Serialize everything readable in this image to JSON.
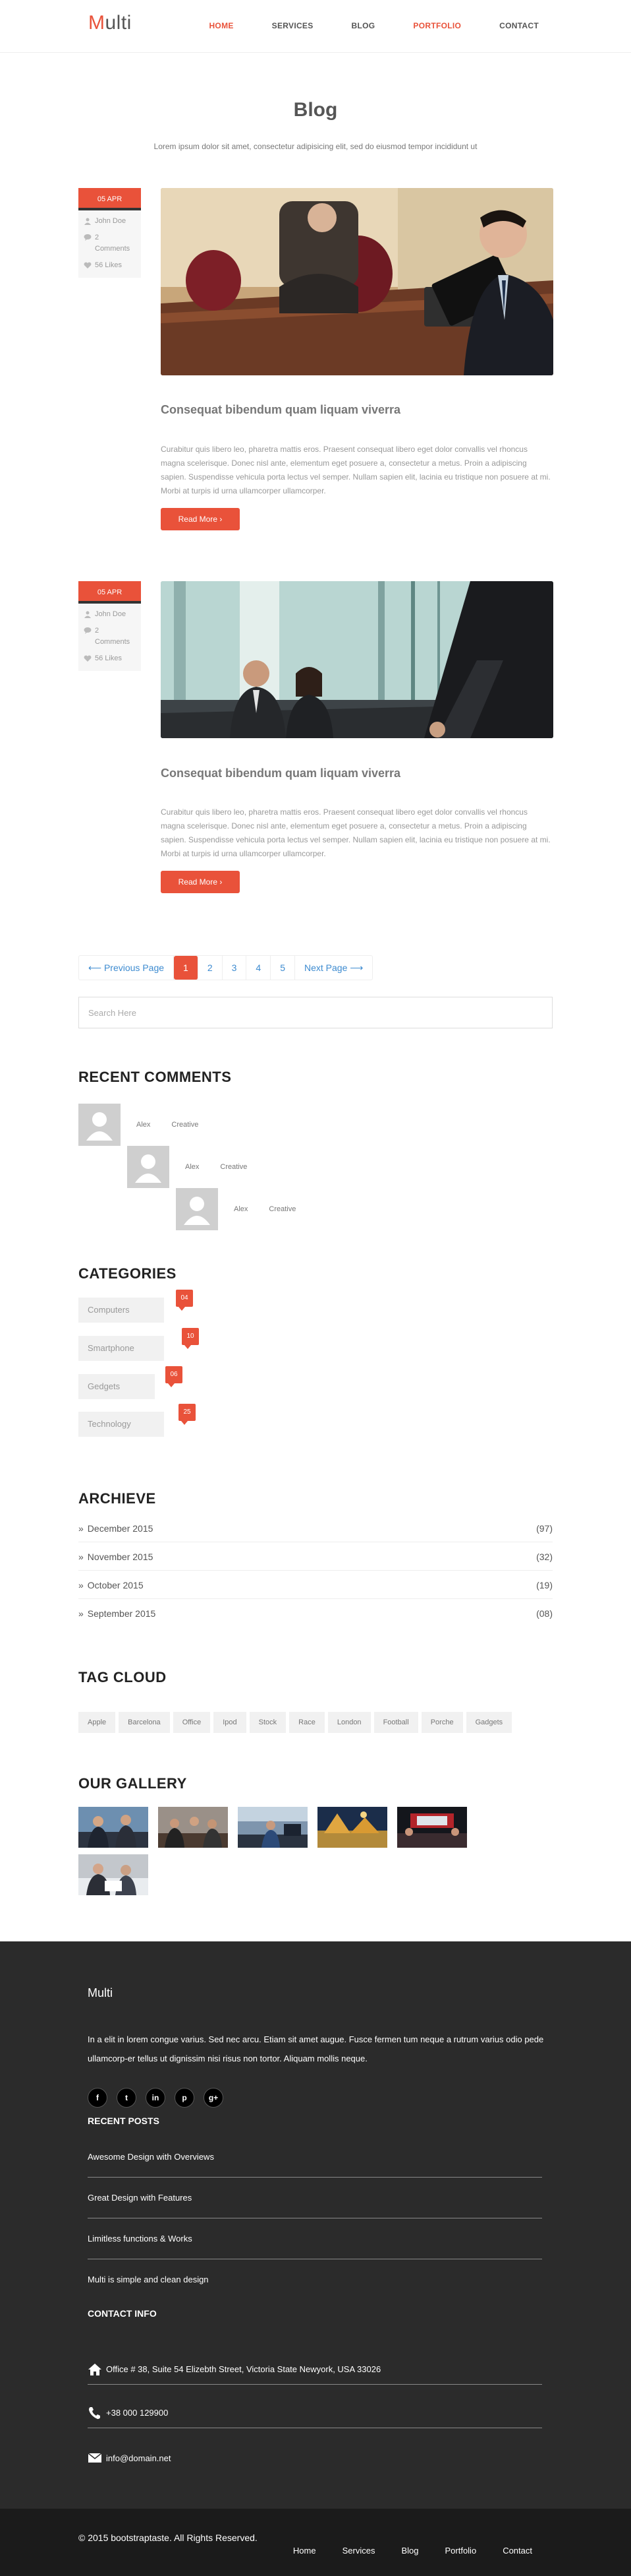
{
  "header": {
    "logo_first": "M",
    "logo_rest": "ulti",
    "nav": [
      {
        "label": "HOME",
        "active": true
      },
      {
        "label": "SERVICES",
        "active": false
      },
      {
        "label": "BLOG",
        "active": false
      },
      {
        "label": "PORTFOLIO",
        "active": true
      },
      {
        "label": "CONTACT",
        "active": false
      }
    ]
  },
  "page": {
    "title": "Blog",
    "subtitle": "Lorem ipsum dolor sit amet, consectetur adipisicing elit, sed do eiusmod tempor incididunt ut"
  },
  "posts": [
    {
      "date": "05 APR",
      "author": "John Doe",
      "comments": "2 Comments",
      "likes": "56 Likes",
      "title": "Consequat bibendum quam liquam viverra",
      "excerpt": "Curabitur quis libero leo, pharetra mattis eros. Praesent consequat libero eget dolor convallis vel rhoncus magna scelerisque. Donec nisl ante, elementum eget posuere a, consectetur a metus. Proin a adipiscing sapien. Suspendisse vehicula porta lectus vel semper. Nullam sapien elit, lacinia eu tristique non posuere at mi. Morbi at turpis id urna ullamcorper ullamcorper.",
      "read_more": "Read More ›"
    },
    {
      "date": "05 APR",
      "author": "John Doe",
      "comments": "2 Comments",
      "likes": "56 Likes",
      "title": "Consequat bibendum quam liquam viverra",
      "excerpt": "Curabitur quis libero leo, pharetra mattis eros. Praesent consequat libero eget dolor convallis vel rhoncus magna scelerisque. Donec nisl ante, elementum eget posuere a, consectetur a metus. Proin a adipiscing sapien. Suspendisse vehicula porta lectus vel semper. Nullam sapien elit, lacinia eu tristique non posuere at mi. Morbi at turpis id urna ullamcorper ullamcorper.",
      "read_more": "Read More ›"
    }
  ],
  "pagination": {
    "prev": "⟵ Previous Page",
    "pages": [
      "1",
      "2",
      "3",
      "4",
      "5"
    ],
    "active": "1",
    "next": "Next Page ⟶"
  },
  "search": {
    "placeholder": "Search Here"
  },
  "recent_comments": {
    "title": "RECENT COMMENTS",
    "items": [
      {
        "name": "Alex",
        "role": "Creative"
      },
      {
        "name": "Alex",
        "role": "Creative"
      },
      {
        "name": "Alex",
        "role": "Creative"
      }
    ]
  },
  "categories": {
    "title": "CATEGORIES",
    "items": [
      {
        "label": "Computers",
        "count": "04"
      },
      {
        "label": "Smartphone",
        "count": "10"
      },
      {
        "label": "Gedgets",
        "count": "06"
      },
      {
        "label": "Technology",
        "count": "25"
      }
    ]
  },
  "archive": {
    "title": "ARCHIEVE",
    "items": [
      {
        "label": "December 2015",
        "count": "(97)"
      },
      {
        "label": "November 2015",
        "count": "(32)"
      },
      {
        "label": "October 2015",
        "count": "(19)"
      },
      {
        "label": "September 2015",
        "count": "(08)"
      }
    ]
  },
  "tag_cloud": {
    "title": "TAG CLOUD",
    "tags": [
      "Apple",
      "Barcelona",
      "Office",
      "Ipod",
      "Stock",
      "Race",
      "London",
      "Football",
      "Porche",
      "Gadgets"
    ]
  },
  "gallery": {
    "title": "OUR GALLERY"
  },
  "footer": {
    "brand": "Multi",
    "text": "In a elit in lorem congue varius. Sed nec arcu. Etiam sit amet augue. Fusce fermen tum neque a rutrum varius odio pede ullamcorp-er tellus ut dignissim nisi risus non tortor. Aliquam mollis neque.",
    "socials": [
      "f",
      "t",
      "in",
      "p",
      "g+"
    ],
    "recent_posts_title": "RECENT POSTS",
    "recent_posts": [
      "Awesome Design with Overviews",
      "Great Design with Features",
      "Limitless functions & Works",
      "Multi is simple and clean design"
    ],
    "contact_title": "CONTACT INFO",
    "contact": {
      "address": "Office # 38, Suite 54 Elizebth Street, Victoria State Newyork, USA 33026",
      "phone": "+38 000 129900",
      "email": "info@domain.net"
    }
  },
  "bottom_bar": {
    "copyright": "© 2015 bootstraptaste. All Rights Reserved.",
    "links": [
      "Home",
      "Services",
      "Blog",
      "Portfolio",
      "Contact"
    ]
  },
  "colors": {
    "accent": "#e9523a",
    "footer_bg": "#2b2b2b",
    "bottom_bg": "#1b1b1b",
    "link": "#3d8bd0"
  }
}
